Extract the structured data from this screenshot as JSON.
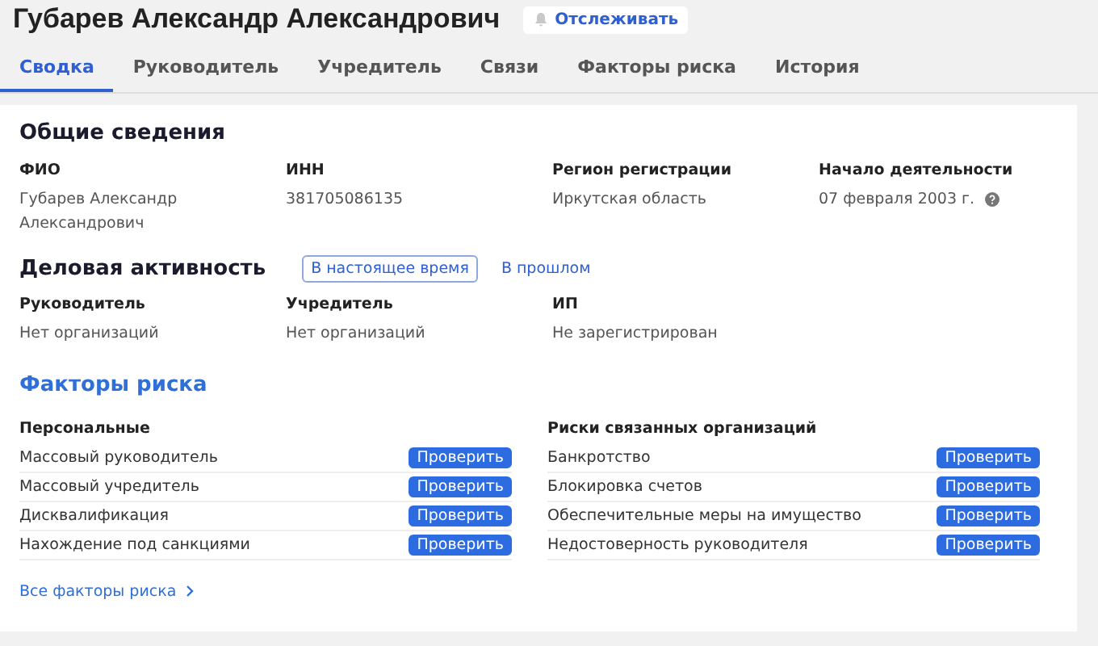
{
  "header": {
    "title": "Губарев Александр Александрович",
    "follow_button": "Отслеживать"
  },
  "tabs": [
    {
      "label": "Сводка",
      "selected": true
    },
    {
      "label": "Руководитель",
      "selected": false
    },
    {
      "label": "Учредитель",
      "selected": false
    },
    {
      "label": "Связи",
      "selected": false
    },
    {
      "label": "Факторы риска",
      "selected": false
    },
    {
      "label": "История",
      "selected": false
    }
  ],
  "general": {
    "title": "Общие сведения",
    "fields": [
      {
        "label": "ФИО",
        "value": "Губарев Александр Александрович"
      },
      {
        "label": "ИНН",
        "value": "381705086135"
      },
      {
        "label": "Регион регистрации",
        "value": "Иркутская область"
      },
      {
        "label": "Начало деятельности",
        "value": "07 февраля 2003 г.",
        "info": true
      }
    ]
  },
  "activity": {
    "title": "Деловая активность",
    "periods": [
      {
        "label": "В настоящее время",
        "selected": true
      },
      {
        "label": "В прошлом",
        "selected": false
      }
    ],
    "fields": [
      {
        "label": "Руководитель",
        "value": "Нет организаций"
      },
      {
        "label": "Учредитель",
        "value": "Нет организаций"
      },
      {
        "label": "ИП",
        "value": "Не зарегистрирован"
      }
    ]
  },
  "risks": {
    "title": "Факторы риска",
    "groups": [
      {
        "title": "Персональные",
        "items": [
          {
            "label": "Массовый руководитель",
            "button": "Проверить"
          },
          {
            "label": "Массовый учредитель",
            "button": "Проверить"
          },
          {
            "label": "Дисквалификация",
            "button": "Проверить"
          },
          {
            "label": "Нахождение под санкциями",
            "button": "Проверить"
          }
        ]
      },
      {
        "title": "Риски связанных организаций",
        "items": [
          {
            "label": "Банкротство",
            "button": "Проверить"
          },
          {
            "label": "Блокировка счетов",
            "button": "Проверить"
          },
          {
            "label": "Обеспечительные меры на имущество",
            "button": "Проверить"
          },
          {
            "label": "Недостоверность руководителя",
            "button": "Проверить"
          }
        ]
      }
    ],
    "all_link": "Все факторы риска"
  }
}
